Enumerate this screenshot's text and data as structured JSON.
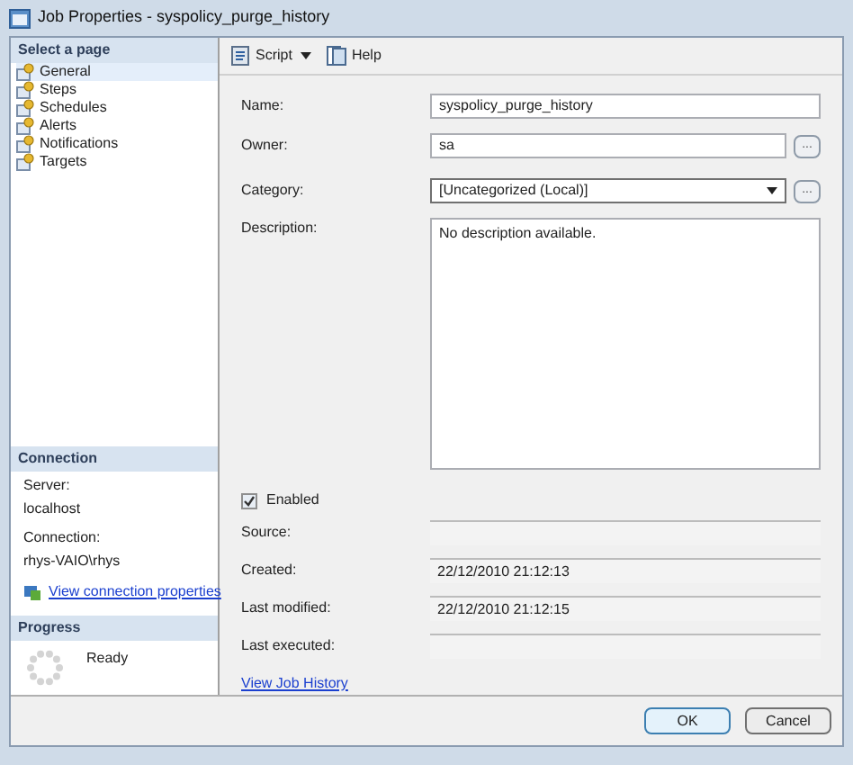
{
  "window": {
    "title": "Job Properties - syspolicy_purge_history"
  },
  "sidebar": {
    "header": "Select a page",
    "items": [
      {
        "label": "General",
        "selected": true
      },
      {
        "label": "Steps",
        "selected": false
      },
      {
        "label": "Schedules",
        "selected": false
      },
      {
        "label": "Alerts",
        "selected": false
      },
      {
        "label": "Notifications",
        "selected": false
      },
      {
        "label": "Targets",
        "selected": false
      }
    ]
  },
  "connection": {
    "header": "Connection",
    "server_label": "Server:",
    "server": "localhost",
    "connection_label": "Connection:",
    "connection": "rhys-VAIO\\rhys",
    "link": "View connection properties"
  },
  "progress": {
    "header": "Progress",
    "status": "Ready"
  },
  "toolbar": {
    "script": "Script",
    "help": "Help"
  },
  "form": {
    "name_label": "Name:",
    "name": "syspolicy_purge_history",
    "owner_label": "Owner:",
    "owner": "sa",
    "owner_browse": "...",
    "category_label": "Category:",
    "category": "[Uncategorized (Local)]",
    "category_browse": "...",
    "description_label": "Description:",
    "description": "No description available.",
    "enabled": {
      "label": "Enabled",
      "checked": true
    },
    "info": [
      {
        "label": "Source:"
      },
      {
        "label": "Created:",
        "value": "22/12/2010 21:12:13"
      },
      {
        "label": "Last modified:",
        "value": "22/12/2010 21:12:15"
      },
      {
        "label": "Last executed:"
      }
    ],
    "history_link": "View Job History"
  },
  "buttons": {
    "ok": "OK",
    "cancel": "Cancel"
  }
}
